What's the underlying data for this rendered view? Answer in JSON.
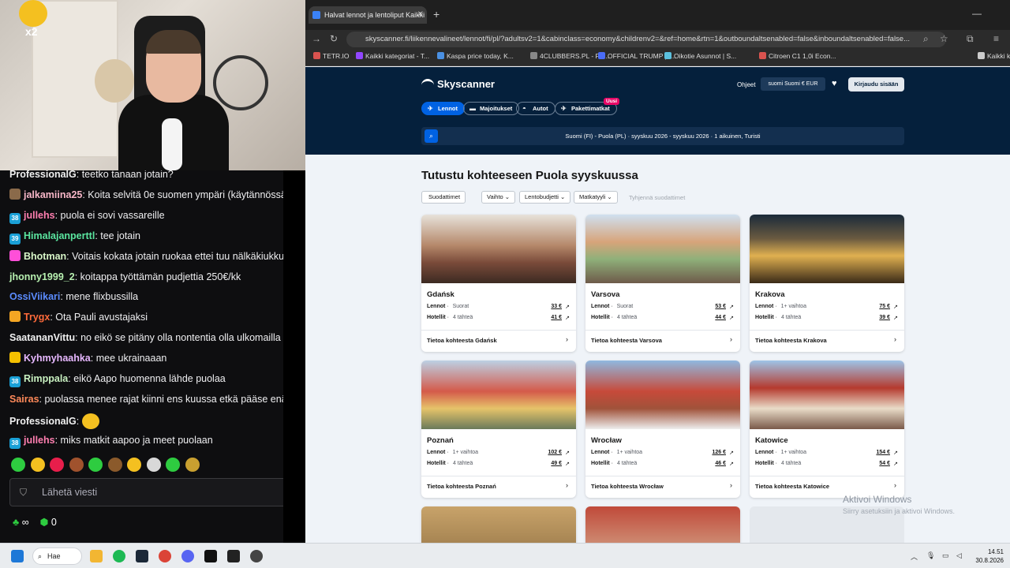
{
  "webcam": {
    "emote_multiplier": "x2"
  },
  "chat": {
    "messages": [
      {
        "user": "ProfessionalG",
        "text": ": teetko tanaan jotain?",
        "color": "#f0f0f0",
        "badge": ""
      },
      {
        "user": "jalkamiina25",
        "text": ": Koita selvitä 0e suomen ympäri (käytännössä",
        "color": "#f8b7c8",
        "badge": "avatar"
      },
      {
        "user": "jullehs",
        "text": ": puola ei sovi vassareille",
        "color": "#ff7fb0",
        "badge": "38"
      },
      {
        "user": "Himalajanperttl",
        "text": ": tee jotain",
        "color": "#5be6a0",
        "badge": "39"
      },
      {
        "user": "Bhotman",
        "text": ": Voitais kokata jotain ruokaa ettei tuu nälkäkiukku",
        "color": "#d8f6c8",
        "badge": "gift"
      },
      {
        "user": "jhonny1999_2",
        "text": ": koitappa työttämän pudjettia 250€/kk",
        "color": "#b7f0b0",
        "badge": ""
      },
      {
        "user": "OssiViikari",
        "text": ": mene flixbussilla",
        "color": "#5b8cff",
        "badge": ""
      },
      {
        "user": "Trygx",
        "text": ": Ota Pauli avustajaksi",
        "color": "#ff6a3a",
        "badge": "crown"
      },
      {
        "user": "SaatananVittu",
        "text": ": no eikö se pitäny olla nontentia olla ulkomailla ?",
        "color": "#f0f0f0",
        "badge": ""
      },
      {
        "user": "Kyhmyhaahka",
        "text": ": mee ukrainaaan",
        "color": "#e7b8ff",
        "badge": "bolt"
      },
      {
        "user": "Rimppala",
        "text": ": eikö Aapo huomenna lähde puolaa",
        "color": "#c8f0c0",
        "badge": "38"
      },
      {
        "user": "Sairas",
        "text": ": puolassa menee rajat kiinni ens kuussa etkä pääse enää",
        "color": "#ff8a5a",
        "badge": ""
      },
      {
        "user": "ProfessionalG",
        "text": ":",
        "color": "#f0f0f0",
        "badge": "",
        "emote": true
      },
      {
        "user": "jullehs",
        "text": ": miks matkit aapoo ja meet puolaan",
        "color": "#ff7fb0",
        "badge": "38"
      }
    ],
    "input_placeholder": "Lähetä viesti",
    "footer_points": "∞",
    "footer_count": "0"
  },
  "browser": {
    "tab_title": "Halvat lennot ja lentoliput Kaikki",
    "url": "skyscanner.fi/liikennevalineet/lennot/fi/pl/?adultsv2=1&cabinclass=economy&childrenv2=&ref=home&rtn=1&outboundaltsenabled=false&inboundaltsenabled=false...",
    "bookmarks": [
      "TETR.IO",
      "Kaikki kategoriat - T...",
      "Kaspa price today, K...",
      "4CLUBBERS.PL - Po...",
      "OFFICIAL TRUMP pr...",
      "Oikotie Asunnot | S...",
      "Citroen C1 1,0i Econ...",
      "Kaikki k"
    ]
  },
  "site": {
    "logo": "Skyscanner",
    "help": "Ohjeet",
    "locale": "suomi  Suomi  € EUR",
    "login": "Kirjaudu sisään",
    "nav": [
      "Lennot",
      "Majoitukset",
      "Autot",
      "Pakettimatkat"
    ],
    "new_badge": "Uusi",
    "search_summary": "Suomi (FI) - Puola (PL)   ·   syyskuu 2026 - syyskuu 2026   ·   1 aikuinen, Turisti",
    "heading": "Tutustu kohteeseen Puola syyskuussa",
    "filters": [
      "Suodattimet",
      "Vaihto ⌄",
      "Lentobudjetti ⌄",
      "Matkatyyli ⌄"
    ],
    "clear_filters": "Tyhjennä suodattimet",
    "flights_label": "Lennot",
    "hotels_label": "Hotellit",
    "cards": [
      {
        "city": "Gdańsk",
        "mode": "Suorat",
        "flight": "33 €",
        "stars": "4 tähteä",
        "hotel": "41 €",
        "link": "Tietoa kohteesta Gdańsk"
      },
      {
        "city": "Varsova",
        "mode": "Suorat",
        "flight": "53 €",
        "stars": "4 tähteä",
        "hotel": "44 €",
        "link": "Tietoa kohteesta Varsova"
      },
      {
        "city": "Krakova",
        "mode": "1+ vaihtoa",
        "flight": "75 €",
        "stars": "4 tähteä",
        "hotel": "39 €",
        "link": "Tietoa kohteesta Krakova"
      },
      {
        "city": "Poznań",
        "mode": "1+ vaihtoa",
        "flight": "102 €",
        "stars": "4 tähteä",
        "hotel": "49 €",
        "link": "Tietoa kohteesta Poznań"
      },
      {
        "city": "Wrocław",
        "mode": "1+ vaihtoa",
        "flight": "126 €",
        "stars": "4 tähteä",
        "hotel": "46 €",
        "link": "Tietoa kohteesta Wrocław"
      },
      {
        "city": "Katowice",
        "mode": "1+ vaihtoa",
        "flight": "154 €",
        "stars": "4 tähteä",
        "hotel": "54 €",
        "link": "Tietoa kohteesta Katowice"
      }
    ]
  },
  "windows_watermark": {
    "line1": "Aktivoi Windows",
    "line2": "Siirry asetuksiin ja aktivoi Windows."
  },
  "taskbar": {
    "search": "Hae",
    "time": "14.51",
    "date": "30.8.2026"
  },
  "colors": {
    "brand_dark": "#05203c",
    "brand_blue": "#0062e3",
    "chat_bg": "#0e0e10"
  }
}
